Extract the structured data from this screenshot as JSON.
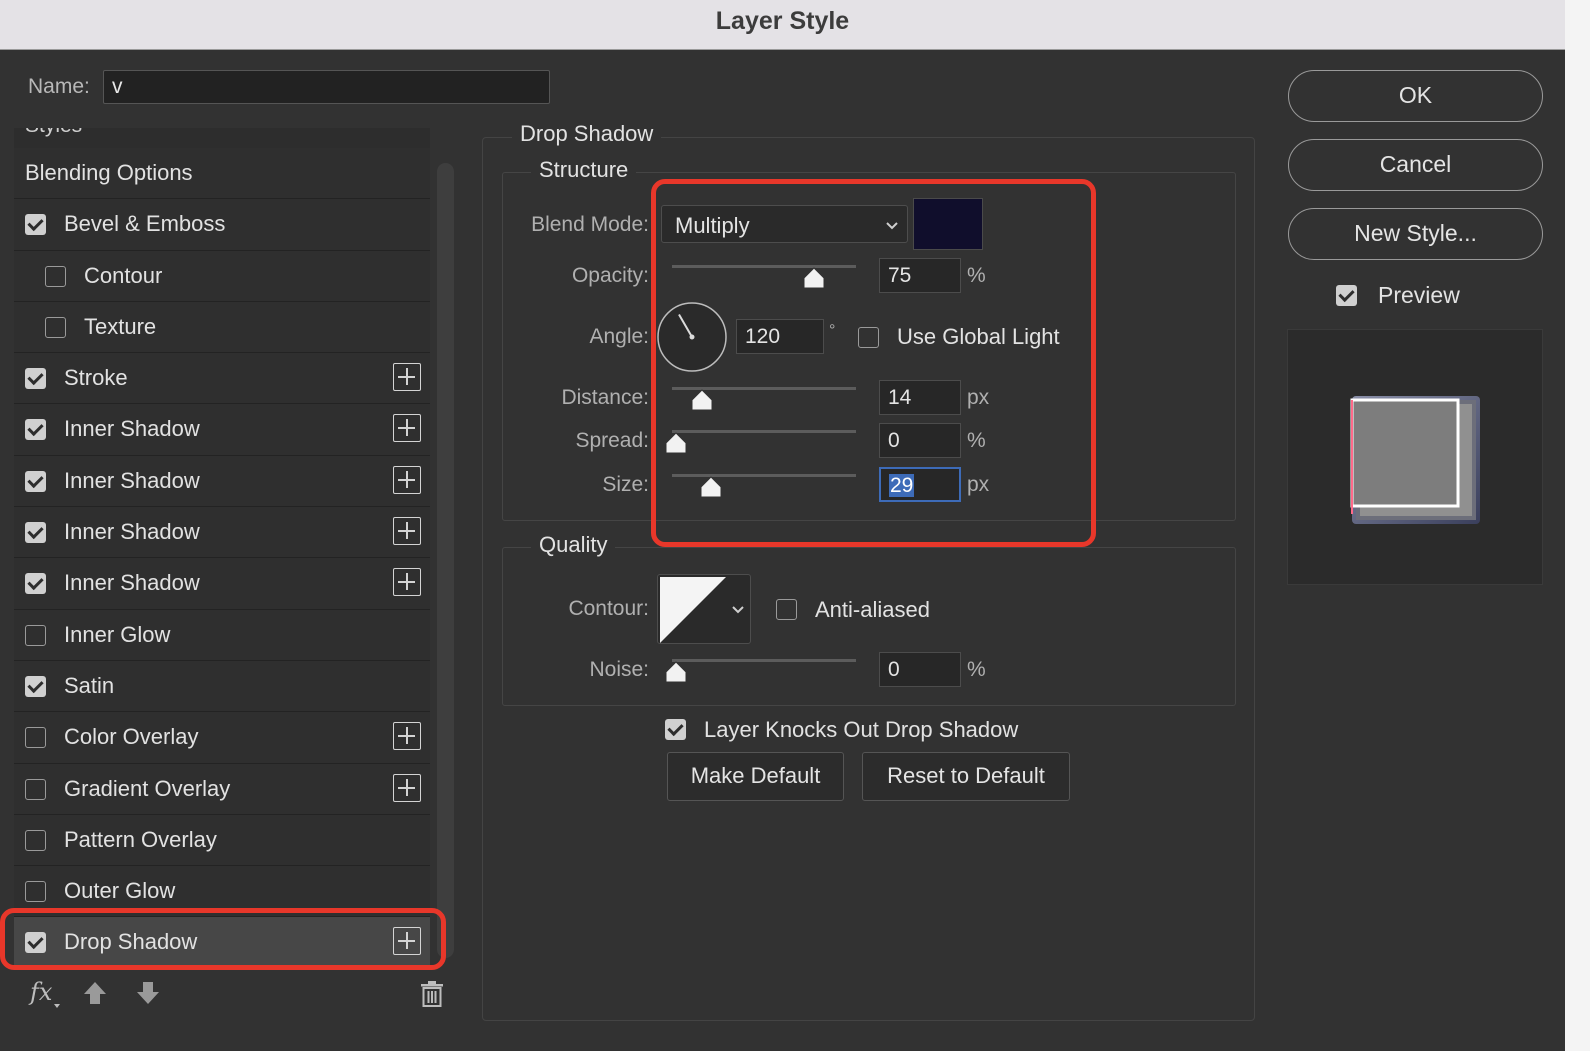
{
  "window": {
    "title": "Layer Style"
  },
  "name_field": {
    "label": "Name:",
    "value": "v"
  },
  "styles": {
    "header": "Styles",
    "items": [
      {
        "label": "Blending Options",
        "checkbox": null,
        "plus": false,
        "indent": false
      },
      {
        "label": "Bevel & Emboss",
        "checkbox": true,
        "plus": false,
        "indent": false
      },
      {
        "label": "Contour",
        "checkbox": false,
        "plus": false,
        "indent": true
      },
      {
        "label": "Texture",
        "checkbox": false,
        "plus": false,
        "indent": true
      },
      {
        "label": "Stroke",
        "checkbox": true,
        "plus": true,
        "indent": false
      },
      {
        "label": "Inner Shadow",
        "checkbox": true,
        "plus": true,
        "indent": false
      },
      {
        "label": "Inner Shadow",
        "checkbox": true,
        "plus": true,
        "indent": false
      },
      {
        "label": "Inner Shadow",
        "checkbox": true,
        "plus": true,
        "indent": false
      },
      {
        "label": "Inner Shadow",
        "checkbox": true,
        "plus": true,
        "indent": false
      },
      {
        "label": "Inner Glow",
        "checkbox": false,
        "plus": false,
        "indent": false
      },
      {
        "label": "Satin",
        "checkbox": true,
        "plus": false,
        "indent": false
      },
      {
        "label": "Color Overlay",
        "checkbox": false,
        "plus": true,
        "indent": false
      },
      {
        "label": "Gradient Overlay",
        "checkbox": false,
        "plus": true,
        "indent": false
      },
      {
        "label": "Pattern Overlay",
        "checkbox": false,
        "plus": false,
        "indent": false
      },
      {
        "label": "Outer Glow",
        "checkbox": false,
        "plus": false,
        "indent": false
      },
      {
        "label": "Drop Shadow",
        "checkbox": true,
        "plus": true,
        "indent": false,
        "selected": true
      }
    ],
    "footer": {
      "fx": "fx",
      "icons": [
        "fx-icon",
        "move-up-icon",
        "move-down-icon",
        "trash-icon"
      ]
    }
  },
  "panel": {
    "title": "Drop Shadow",
    "structure": {
      "title": "Structure",
      "blend_mode": {
        "label": "Blend Mode:",
        "value": "Multiply",
        "color": "#100e2c"
      },
      "opacity": {
        "label": "Opacity:",
        "value": "75",
        "unit": "%",
        "fraction": 0.75
      },
      "angle": {
        "label": "Angle:",
        "value": "120",
        "unit": "°",
        "degrees": 120
      },
      "use_global_light": {
        "label": "Use Global Light",
        "checked": false
      },
      "distance": {
        "label": "Distance:",
        "value": "14",
        "unit": "px",
        "fraction": 0.14
      },
      "spread": {
        "label": "Spread:",
        "value": "0",
        "unit": "%",
        "fraction": 0
      },
      "size": {
        "label": "Size:",
        "value": "29",
        "unit": "px",
        "fraction": 0.19
      }
    },
    "quality": {
      "title": "Quality",
      "contour": {
        "label": "Contour:"
      },
      "anti_aliased": {
        "label": "Anti-aliased",
        "checked": false
      },
      "noise": {
        "label": "Noise:",
        "value": "0",
        "unit": "%",
        "fraction": 0
      }
    },
    "knocks_out": {
      "label": "Layer Knocks Out Drop Shadow",
      "checked": true
    },
    "make_default": "Make Default",
    "reset_default": "Reset to Default"
  },
  "actions": {
    "ok": "OK",
    "cancel": "Cancel",
    "new_style": "New Style...",
    "preview": {
      "label": "Preview",
      "checked": true
    }
  },
  "colors": {
    "highlight": "#e8372a",
    "selection": "#3d6bb8"
  }
}
